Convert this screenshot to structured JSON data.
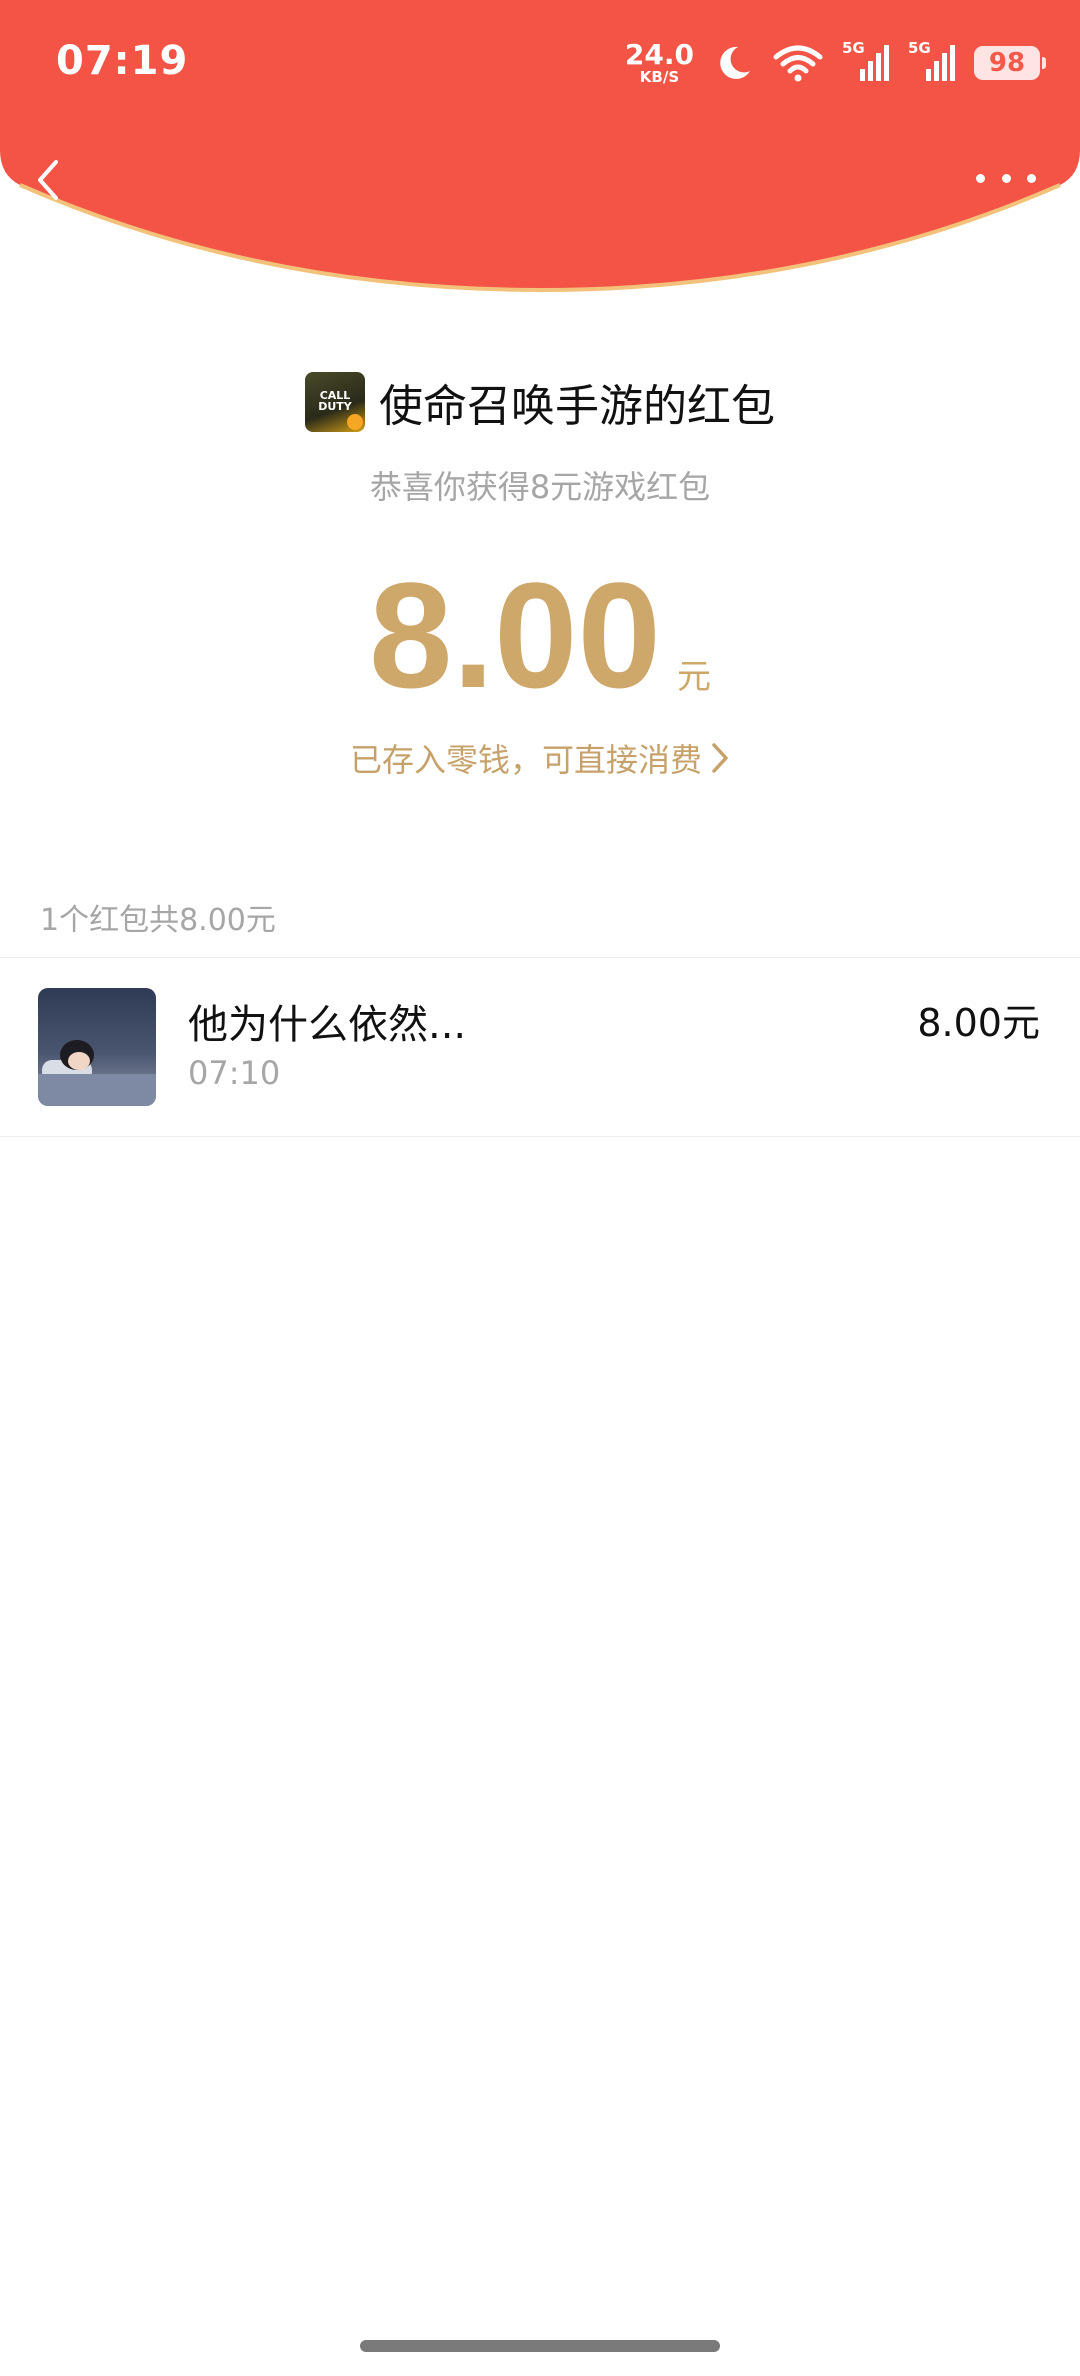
{
  "colors": {
    "header_red": "#f35446",
    "header_edge": "#f3c27a",
    "gold": "#cea76a",
    "muted": "#a6a6a6"
  },
  "status_bar": {
    "time": "07:19",
    "net_speed_value": "24.0",
    "net_speed_unit": "KB/S",
    "icons": [
      "moon-icon",
      "wifi-icon",
      "signal-5g-icon",
      "signal-5g-icon"
    ],
    "signal_label": "5G",
    "battery": "98"
  },
  "nav": {
    "back_icon": "chevron-left-icon",
    "more_icon": "more-dots-icon"
  },
  "sender": {
    "icon_text": "CALL DUTY",
    "title": "使命召唤手游的红包",
    "subtitle": "恭喜你获得8元游戏红包"
  },
  "amount": {
    "value": "8.00",
    "unit": "元",
    "stored_text": "已存入零钱，可直接消费"
  },
  "summary": "1个红包共8.00元",
  "records": [
    {
      "name": "他为什么依然...",
      "time": "07:10",
      "amount": "8.00元"
    }
  ]
}
